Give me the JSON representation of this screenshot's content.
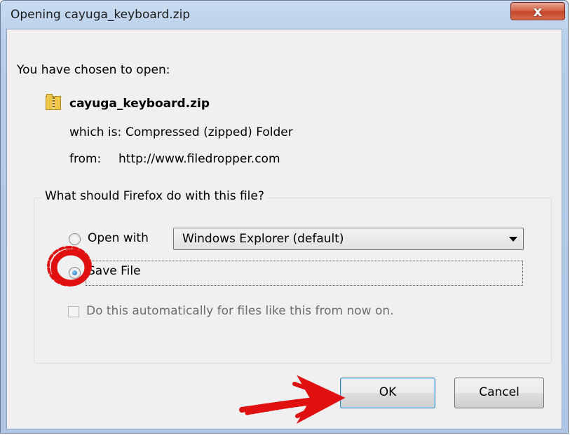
{
  "window": {
    "title": "Opening cayuga_keyboard.zip",
    "close_label": "x"
  },
  "dialog": {
    "chosen_to_open": "You have chosen to open:",
    "file_name": "cayuga_keyboard.zip",
    "which_is_label": "which is:",
    "which_is_value": "Compressed (zipped) Folder",
    "from_label": "from:",
    "from_value": "http://www.filedropper.com"
  },
  "action_group": {
    "legend": "What should Firefox do with this file?",
    "open_with_label": "Open with",
    "open_with_selected": "Windows Explorer (default)",
    "save_file_label": "Save File",
    "selected_option": "Save File",
    "auto_checkbox_label": "Do this automatically for files like this from now on.",
    "auto_checkbox_checked": false
  },
  "buttons": {
    "ok": "OK",
    "cancel": "Cancel"
  },
  "colors": {
    "annotation": "#e01010",
    "window_frame": "#b6cde9",
    "client_bg": "#f0f0f0"
  },
  "icons": [
    "zip-folder-icon",
    "close-icon",
    "chevron-down-icon"
  ]
}
